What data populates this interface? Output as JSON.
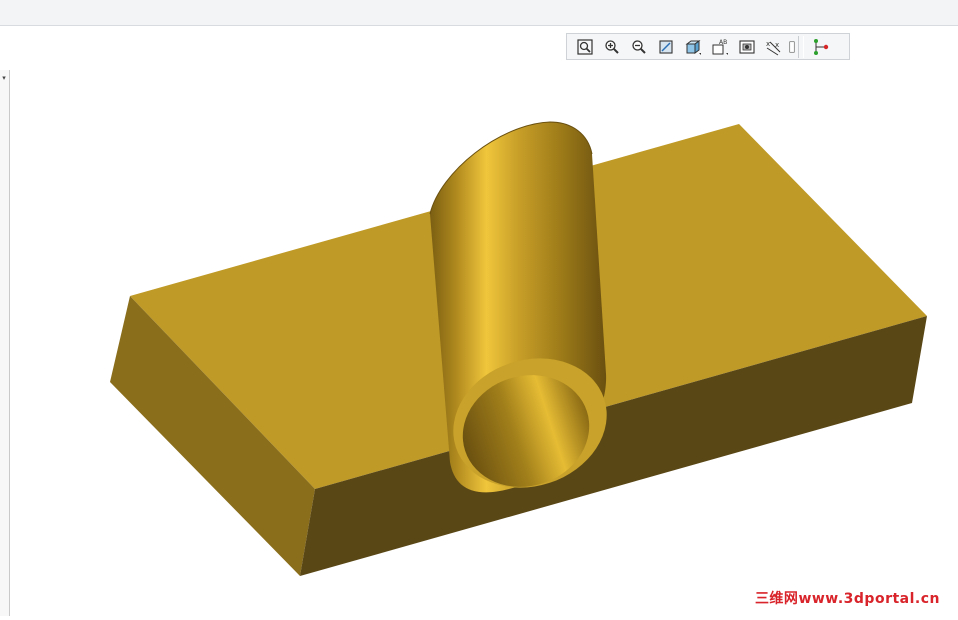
{
  "toolbar": {
    "items": [
      {
        "name": "refit-icon"
      },
      {
        "name": "zoom-in-icon"
      },
      {
        "name": "zoom-out-icon"
      },
      {
        "name": "repaint-icon"
      },
      {
        "name": "display-style-icon"
      },
      {
        "name": "saved-views-icon"
      },
      {
        "name": "view-manager-icon"
      },
      {
        "name": "datum-display-icon"
      },
      {
        "name": "partial-hidden-icon"
      },
      {
        "name": "model-tree-icon"
      }
    ]
  },
  "model": {
    "colors": {
      "top": "#bf9a26",
      "front": "#5a4716",
      "left": "#8a6e1c",
      "cylinder_light": "#f0c63c",
      "cylinder_dark": "#7a5e12"
    }
  },
  "watermark": {
    "cn": "三维网",
    "url": "www.3dportal.cn"
  }
}
